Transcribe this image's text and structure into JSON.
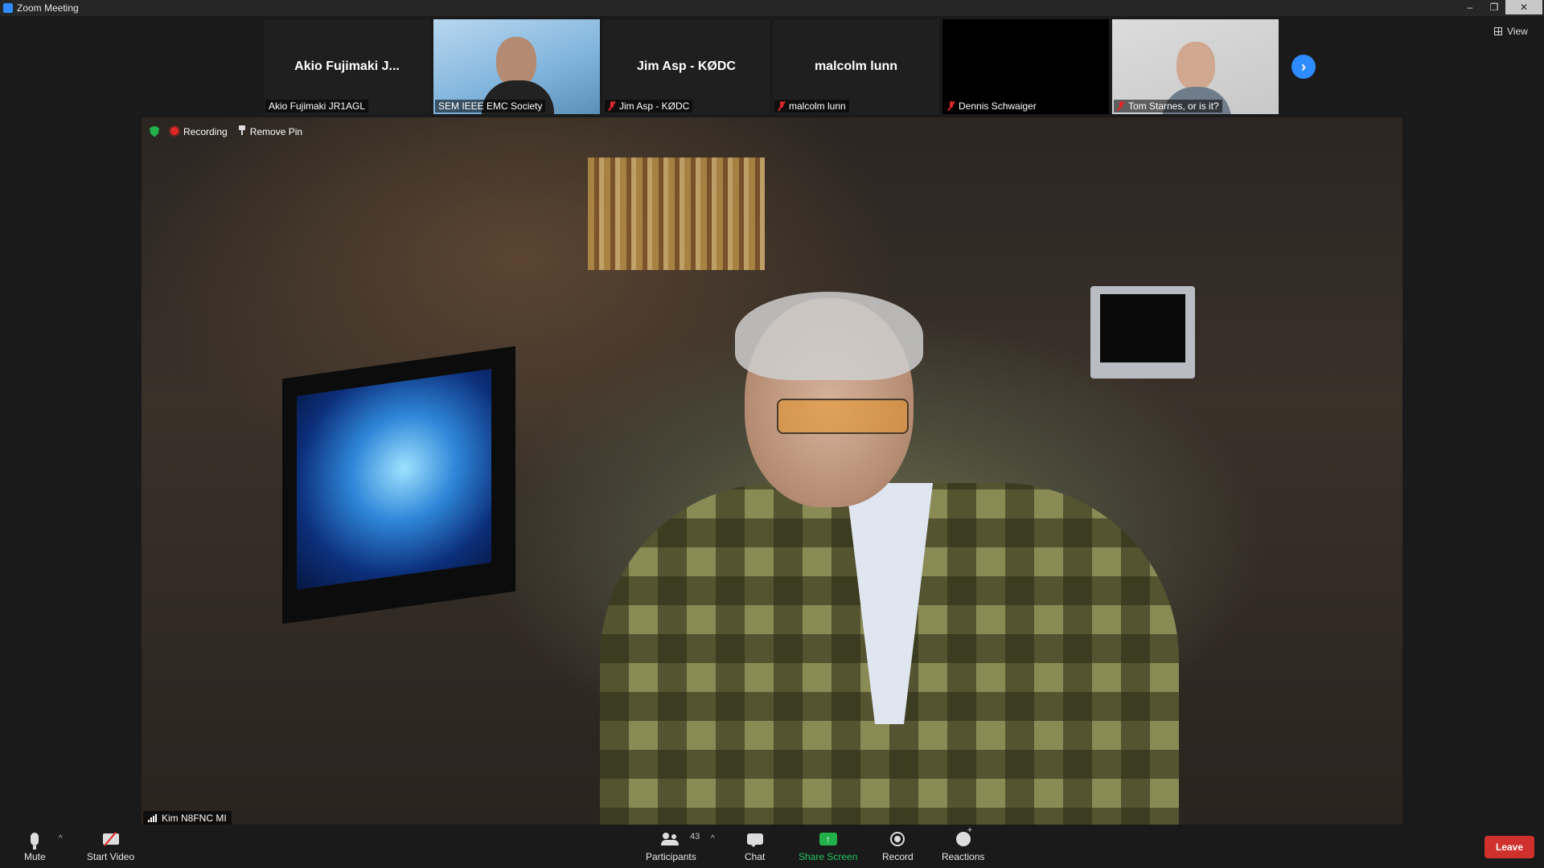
{
  "window": {
    "title": "Zoom Meeting",
    "min": "–",
    "max": "❐",
    "close": "✕"
  },
  "view_button": {
    "label": "View"
  },
  "thumbnails": [
    {
      "big_name": "Akio Fujimaki  J...",
      "label": "Akio Fujimaki  JR1AGL",
      "muted": false,
      "video": "none"
    },
    {
      "big_name": "",
      "label": "SEM IEEE EMC Society",
      "muted": false,
      "video": "camera"
    },
    {
      "big_name": "Jim Asp - KØDC",
      "label": "Jim Asp - KØDC",
      "muted": true,
      "video": "none"
    },
    {
      "big_name": "malcolm lunn",
      "label": "malcolm lunn",
      "muted": true,
      "video": "none"
    },
    {
      "big_name": "",
      "label": "Dennis Schwaiger",
      "muted": true,
      "video": "black"
    },
    {
      "big_name": "",
      "label": "Tom Starnes, or is it?",
      "muted": true,
      "video": "camera"
    }
  ],
  "main": {
    "recording_label": "Recording",
    "remove_pin_label": "Remove Pin",
    "speaker_name": "Kim N8FNC MI"
  },
  "toolbar": {
    "mute_label": "Mute",
    "start_video_label": "Start Video",
    "participants_label": "Participants",
    "participants_count": "43",
    "chat_label": "Chat",
    "share_label": "Share Screen",
    "record_label": "Record",
    "reactions_label": "Reactions",
    "leave_label": "Leave",
    "caret": "^",
    "share_arrow": "↑"
  },
  "next_arrow": "›",
  "colors": {
    "accent": "#2d8cff",
    "leave": "#d0312d",
    "share": "#22b04a",
    "muted": "#e02828"
  }
}
